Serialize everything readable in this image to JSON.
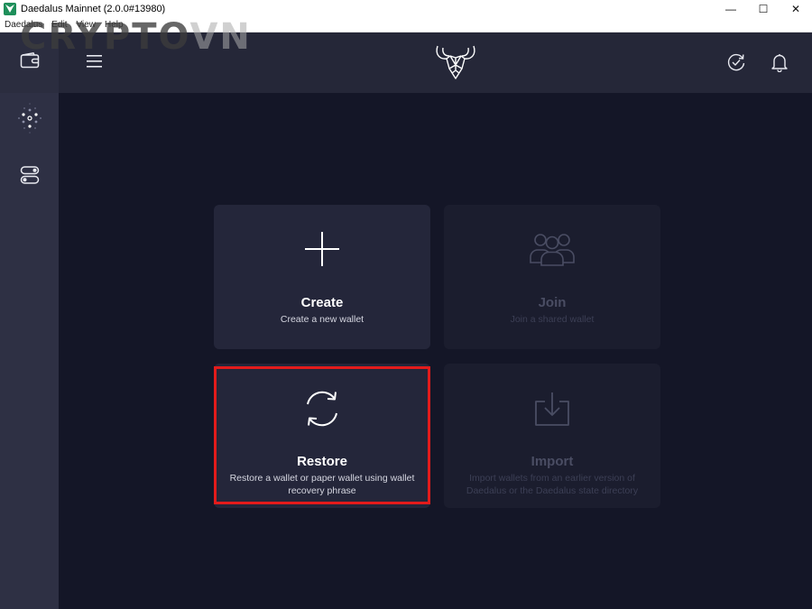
{
  "window": {
    "title": "Daedalus Mainnet (2.0.0#13980)",
    "minimize_glyph": "—",
    "maximize_glyph": "☐",
    "close_glyph": "✕"
  },
  "menu": [
    "Daedalus",
    "Edit",
    "View",
    "Help"
  ],
  "watermark": {
    "part1": "CRYPTO",
    "part2": "VN"
  },
  "sidebar": {
    "items": [
      {
        "icon": "wallet-icon"
      },
      {
        "icon": "cardano-network-icon"
      },
      {
        "icon": "settings-toggle-icon"
      }
    ]
  },
  "topbar": {
    "icons": [
      "hamburger-icon",
      "daedalus-logo",
      "sync-icon",
      "bell-icon"
    ]
  },
  "cards": [
    {
      "id": "create",
      "title": "Create",
      "description": "Create a new wallet",
      "icon": "plus-icon",
      "enabled": true
    },
    {
      "id": "join",
      "title": "Join",
      "description": "Join a shared wallet",
      "icon": "users-icon",
      "enabled": false
    },
    {
      "id": "restore",
      "title": "Restore",
      "description": "Restore a wallet or paper wallet using wallet recovery phrase",
      "icon": "restore-icon",
      "enabled": true,
      "highlighted": true
    },
    {
      "id": "import",
      "title": "Import",
      "description": "Import wallets from an earlier version of Daedalus or the Daedalus state directory",
      "icon": "import-icon",
      "enabled": false
    }
  ],
  "colors": {
    "background": "#141627",
    "sidebar": "#2e3044",
    "topbar": "#252738",
    "card": "#24263a",
    "highlight": "#e31b1b"
  }
}
